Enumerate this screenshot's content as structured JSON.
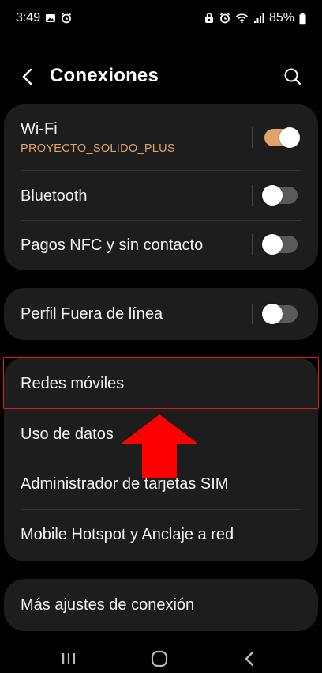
{
  "status_bar": {
    "time": "3:49",
    "battery": "85%",
    "icons_left": [
      "image-icon",
      "alarm-icon"
    ],
    "icons_right": [
      "lock-icon",
      "alarm-icon",
      "wifi-icon",
      "signal-icon",
      "battery-icon"
    ]
  },
  "header": {
    "title": "Conexiones",
    "back_icon": "chevron-left-icon",
    "search_icon": "search-icon"
  },
  "section1": {
    "wifi": {
      "label": "Wi-Fi",
      "network": "PROYECTO_SOLIDO_PLUS",
      "toggle": true
    },
    "bluetooth": {
      "label": "Bluetooth",
      "toggle": false
    },
    "nfc": {
      "label": "Pagos NFC y sin contacto",
      "toggle": false
    }
  },
  "section2": {
    "airplane": {
      "label": "Perfil Fuera de línea",
      "toggle": false
    }
  },
  "section3": {
    "items": [
      {
        "label": "Redes móviles"
      },
      {
        "label": "Uso de datos"
      },
      {
        "label": "Administrador de tarjetas SIM"
      },
      {
        "label": "Mobile Hotspot y Anclaje a red"
      }
    ]
  },
  "section4": {
    "more": {
      "label": "Más ajustes de conexión"
    }
  },
  "colors": {
    "accent": "#e0a36a",
    "card_bg": "#1d1d1d",
    "highlight": "#e01a1a",
    "arrow": "#ff0000"
  },
  "nav_bar": [
    "recents-icon",
    "home-icon",
    "back-icon"
  ]
}
